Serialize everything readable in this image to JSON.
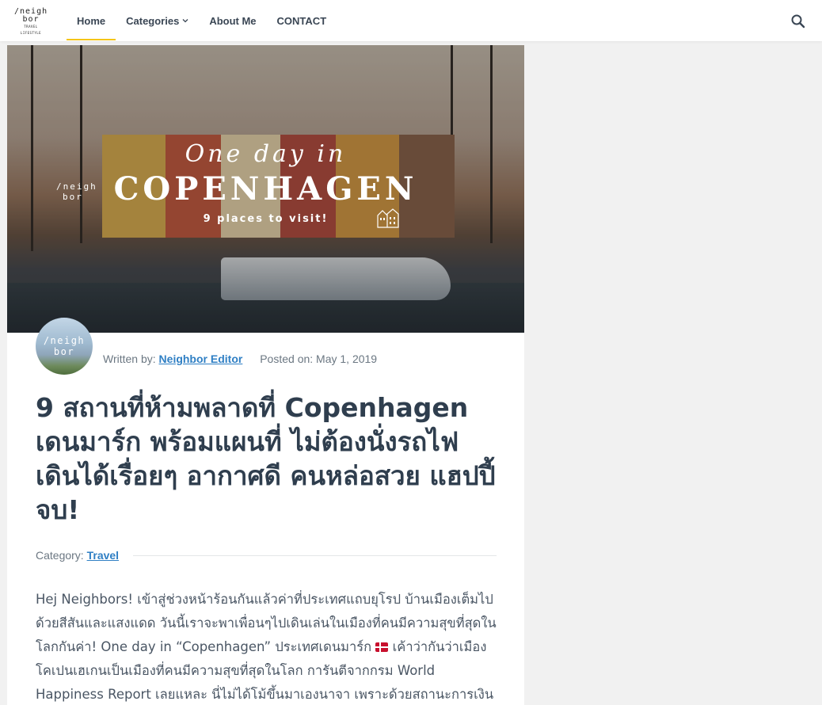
{
  "header": {
    "logo": {
      "line1": "/neigh",
      "line2": "bor",
      "line3": "TRAVEL LIFESTYLE"
    },
    "nav": [
      {
        "label": "Home",
        "active": true
      },
      {
        "label": "Categories",
        "has_dropdown": true
      },
      {
        "label": "About Me"
      },
      {
        "label": "CONTACT"
      }
    ],
    "search_icon": "search-icon",
    "accent_color": "#f5c518"
  },
  "hero": {
    "script_text": "One day in",
    "title_text": "COPENHAGEN",
    "subtitle_text": "9 places to visit!",
    "logo_line1": "/neigh",
    "logo_line2": "bor"
  },
  "author": {
    "avatar_line1": "/neigh",
    "avatar_line2": "bor",
    "written_by_label": "Written by:",
    "name": "Neighbor Editor",
    "posted_label": "Posted on:",
    "date": "May 1, 2019"
  },
  "post": {
    "title": "9 สถานที่ห้ามพลาดที่ Copenhagen เดนมาร์ก พร้อมแผนที่ ไม่ต้องนั่งรถไฟ เดินได้เรื่อยๆ อากาศดี คนหล่อสวย แฮปปี้จบ!",
    "category_label": "Category:",
    "category": "Travel",
    "body_part1": "Hej Neighbors! เข้าสู่ช่วงหน้าร้อนกันแล้วค่าที่ประเทศแถบยุโรป บ้านเมืองเต็มไปด้วยสีสันและแสงแดด วันนี้เราจะพาเพื่อนๆไปเดินเล่นในเมืองที่คนมีความสุขที่สุดในโลกกันค่า! One day in “Copenhagen” ประเทศเดนมาร์ก",
    "body_part2": "เค้าว่ากันว่าเมืองโคเปนเฮเกนเป็นเมืองที่คนมีความสุขที่สุดในโลก การันตีจากกรม World Happiness Report เลยแหละ นี่ไม่ได้โม้ขึ้นมาเองนาจา เพราะด้วยสถานะการเงินของประเทศ /การศึกษาของประชาชน /",
    "flag_icon": "denmark-flag-icon",
    "link_color": "#2f7fc4"
  }
}
